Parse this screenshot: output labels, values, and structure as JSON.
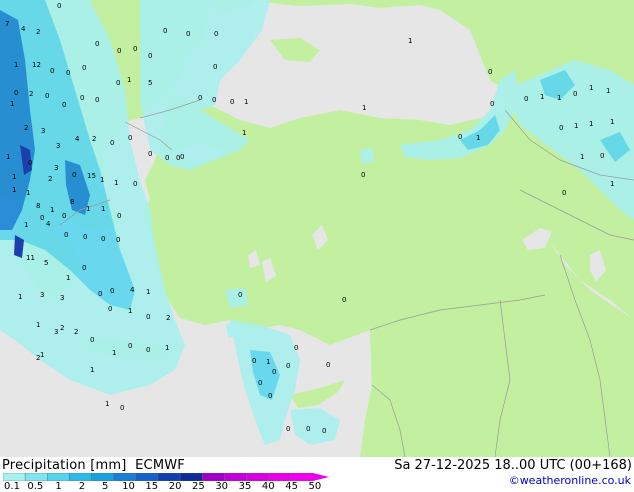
{
  "footer": {
    "title": "Precipitation [mm]",
    "model": "ECMWF",
    "datetime": "Sa 27-12-2025 18..00 UTC (00+168)",
    "credit": "©weatheronline.co.uk"
  },
  "legend": {
    "ticks": [
      "0.1",
      "0.5",
      "1",
      "2",
      "5",
      "10",
      "15",
      "20",
      "25",
      "30",
      "35",
      "40",
      "45",
      "50"
    ],
    "colors": [
      "#a6f0f0",
      "#7fe3f0",
      "#55d2ee",
      "#2db9e8",
      "#1aa0de",
      "#1a7ed6",
      "#155fc8",
      "#123fb0",
      "#0e2b96",
      "#a000c8",
      "#c000d8",
      "#d800e0",
      "#e800e8",
      "#f000f0"
    ]
  },
  "map": {
    "colors": {
      "land": "#c2f0a0",
      "sea": "#e6e6e6",
      "border": "#9a9a9a",
      "coast": "#8a8a8a",
      "precip_light": "#aaf0ee",
      "precip_mid": "#5fd6ee",
      "precip_heavy": "#1a86d6",
      "precip_max": "#1030b0"
    },
    "values": [
      "7",
      "4",
      "2",
      "0",
      "0",
      "0",
      "0",
      "0",
      "0",
      "0",
      "12",
      "1",
      "0",
      "0",
      "0",
      "0",
      "1",
      "5",
      "0",
      "2",
      "1",
      "0",
      "0",
      "0",
      "0",
      "0",
      "0",
      "0",
      "1",
      "0",
      "2",
      "3",
      "3",
      "4",
      "2",
      "0",
      "0",
      "0",
      "0",
      "0",
      "1",
      "1",
      "0",
      "2",
      "3",
      "0",
      "15",
      "1",
      "1",
      "0",
      "1",
      "1",
      "8",
      "1",
      "8",
      "1",
      "1",
      "0",
      "0",
      "0",
      "1",
      "4",
      "0",
      "0",
      "0",
      "0",
      "11",
      "5",
      "1",
      "0",
      "3",
      "3",
      "0",
      "0",
      "4",
      "1",
      "1",
      "2",
      "0",
      "1",
      "0",
      "2",
      "1",
      "3",
      "2",
      "0",
      "1",
      "0",
      "0",
      "1",
      "2",
      "1",
      "1",
      "0",
      "1",
      "0",
      "0",
      "1",
      "0",
      "0",
      "0",
      "0",
      "0",
      "0",
      "0",
      "0",
      "0",
      "0",
      "0",
      "1",
      "0",
      "1",
      "1",
      "0",
      "0",
      "0",
      "0",
      "1",
      "0",
      "1",
      "1",
      "0",
      "1",
      "1",
      "0",
      "1",
      "1",
      "1",
      "1",
      "0",
      "1",
      "0"
    ]
  }
}
